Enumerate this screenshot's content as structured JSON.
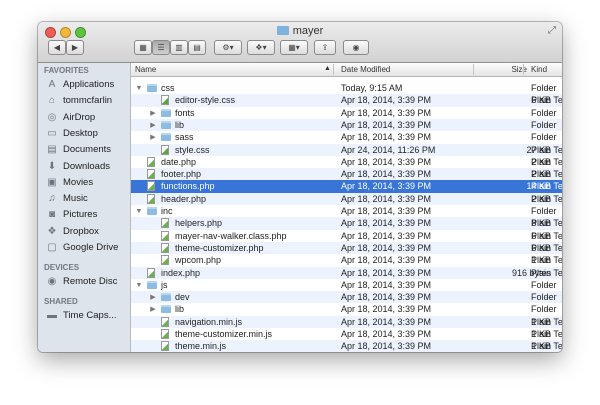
{
  "window": {
    "title": "mayer"
  },
  "toolbar": {
    "back_label": "◀",
    "forward_label": "▶",
    "view_icons": [
      "grid-view-icon",
      "list-view-icon",
      "column-view-icon",
      "coverflow-view-icon"
    ],
    "action_label": "⚙▾",
    "dropbox_label": "▾",
    "arrange_label": "▦▾",
    "share_label": "⇪",
    "tag_label": "◉"
  },
  "sidebar": {
    "favorites_header": "FAVORITES",
    "favorites": [
      {
        "label": "Applications",
        "icon": "applications-icon",
        "glyph": "A"
      },
      {
        "label": "tommcfarlin",
        "icon": "home-icon",
        "glyph": "⌂"
      },
      {
        "label": "AirDrop",
        "icon": "airdrop-icon",
        "glyph": "◎"
      },
      {
        "label": "Desktop",
        "icon": "desktop-icon",
        "glyph": "▭"
      },
      {
        "label": "Documents",
        "icon": "documents-icon",
        "glyph": "▤"
      },
      {
        "label": "Downloads",
        "icon": "downloads-icon",
        "glyph": "⬇"
      },
      {
        "label": "Movies",
        "icon": "movies-icon",
        "glyph": "▣"
      },
      {
        "label": "Music",
        "icon": "music-icon",
        "glyph": "♫"
      },
      {
        "label": "Pictures",
        "icon": "pictures-icon",
        "glyph": "◙"
      },
      {
        "label": "Dropbox",
        "icon": "dropbox-icon",
        "glyph": "❖"
      },
      {
        "label": "Google Drive",
        "icon": "google-drive-icon",
        "glyph": "▢"
      }
    ],
    "devices_header": "DEVICES",
    "devices": [
      {
        "label": "Remote Disc",
        "icon": "remote-disc-icon",
        "glyph": "◉"
      }
    ],
    "shared_header": "SHARED",
    "shared": [
      {
        "label": "Time Caps...",
        "icon": "time-capsule-icon",
        "glyph": "▬"
      }
    ]
  },
  "columns": {
    "name": "Name",
    "date": "Date Modified",
    "size": "Size",
    "kind": "Kind"
  },
  "files": [
    {
      "name": "css",
      "type": "folder",
      "depth": 0,
      "expanded": true,
      "date": "Today, 9:15 AM",
      "size": "--",
      "kind": "Folder"
    },
    {
      "name": "editor-style.css",
      "type": "css",
      "depth": 1,
      "date": "Apr 18, 2014, 3:39 PM",
      "size": "6 KB",
      "kind": "Plain Te"
    },
    {
      "name": "fonts",
      "type": "folder",
      "depth": 1,
      "expanded": false,
      "date": "Apr 18, 2014, 3:39 PM",
      "size": "--",
      "kind": "Folder"
    },
    {
      "name": "lib",
      "type": "folder",
      "depth": 1,
      "expanded": false,
      "date": "Apr 18, 2014, 3:39 PM",
      "size": "--",
      "kind": "Folder"
    },
    {
      "name": "sass",
      "type": "folder",
      "depth": 1,
      "expanded": false,
      "date": "Apr 18, 2014, 3:39 PM",
      "size": "--",
      "kind": "Folder"
    },
    {
      "name": "style.css",
      "type": "css",
      "depth": 1,
      "date": "Apr 24, 2014, 11:26 PM",
      "size": "27 KB",
      "kind": "Plain Te"
    },
    {
      "name": "date.php",
      "type": "file",
      "depth": 0,
      "date": "Apr 18, 2014, 3:39 PM",
      "size": "2 KB",
      "kind": "Plain Te"
    },
    {
      "name": "footer.php",
      "type": "file",
      "depth": 0,
      "date": "Apr 18, 2014, 3:39 PM",
      "size": "2 KB",
      "kind": "Plain Te"
    },
    {
      "name": "functions.php",
      "type": "file",
      "depth": 0,
      "selected": true,
      "date": "Apr 18, 2014, 3:39 PM",
      "size": "14 KB",
      "kind": "Plain Te"
    },
    {
      "name": "header.php",
      "type": "file",
      "depth": 0,
      "date": "Apr 18, 2014, 3:39 PM",
      "size": "2 KB",
      "kind": "Plain Te"
    },
    {
      "name": "inc",
      "type": "folder",
      "depth": 0,
      "expanded": true,
      "date": "Apr 18, 2014, 3:39 PM",
      "size": "--",
      "kind": "Folder"
    },
    {
      "name": "helpers.php",
      "type": "file",
      "depth": 1,
      "date": "Apr 18, 2014, 3:39 PM",
      "size": "8 KB",
      "kind": "Plain Te"
    },
    {
      "name": "mayer-nav-walker.class.php",
      "type": "file",
      "depth": 1,
      "date": "Apr 18, 2014, 3:39 PM",
      "size": "6 KB",
      "kind": "Plain Te"
    },
    {
      "name": "theme-customizer.php",
      "type": "file",
      "depth": 1,
      "date": "Apr 18, 2014, 3:39 PM",
      "size": "6 KB",
      "kind": "Plain Te"
    },
    {
      "name": "wpcom.php",
      "type": "file",
      "depth": 1,
      "date": "Apr 18, 2014, 3:39 PM",
      "size": "1 KB",
      "kind": "Plain Te"
    },
    {
      "name": "index.php",
      "type": "file",
      "depth": 0,
      "date": "Apr 18, 2014, 3:39 PM",
      "size": "916 bytes",
      "kind": "Plain Te"
    },
    {
      "name": "js",
      "type": "folder",
      "depth": 0,
      "expanded": true,
      "date": "Apr 18, 2014, 3:39 PM",
      "size": "--",
      "kind": "Folder"
    },
    {
      "name": "dev",
      "type": "folder",
      "depth": 1,
      "expanded": false,
      "date": "Apr 18, 2014, 3:39 PM",
      "size": "--",
      "kind": "Folder"
    },
    {
      "name": "lib",
      "type": "folder",
      "depth": 1,
      "expanded": false,
      "date": "Apr 18, 2014, 3:39 PM",
      "size": "--",
      "kind": "Folder"
    },
    {
      "name": "navigation.min.js",
      "type": "file",
      "depth": 1,
      "date": "Apr 18, 2014, 3:39 PM",
      "size": "1 KB",
      "kind": "Plain Te"
    },
    {
      "name": "theme-customizer.min.js",
      "type": "file",
      "depth": 1,
      "date": "Apr 18, 2014, 3:39 PM",
      "size": "1 KB",
      "kind": "Plain Te"
    },
    {
      "name": "theme.min.js",
      "type": "file",
      "depth": 1,
      "date": "Apr 18, 2014, 3:39 PM",
      "size": "1 KB",
      "kind": "Plain Te"
    }
  ]
}
